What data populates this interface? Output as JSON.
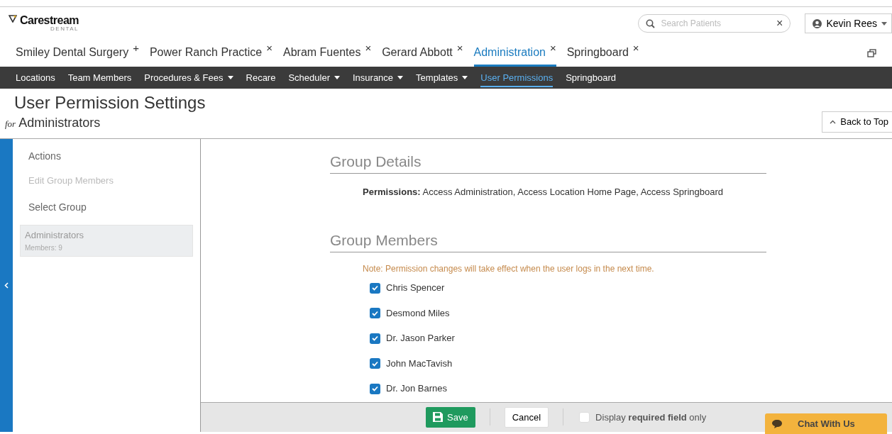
{
  "logo": {
    "name": "Carestream",
    "sub": "DENTAL"
  },
  "search": {
    "placeholder": "Search Patients",
    "clear": "×"
  },
  "user": {
    "name": "Kevin Rees"
  },
  "tabs": [
    {
      "label": "Smiley Dental Surgery",
      "mark": "+",
      "selected": false
    },
    {
      "label": "Power Ranch Practice",
      "mark": "×",
      "selected": false
    },
    {
      "label": "Abram Fuentes",
      "mark": "×",
      "selected": false
    },
    {
      "label": "Gerard Abbott",
      "mark": "×",
      "selected": false
    },
    {
      "label": "Administration",
      "mark": "×",
      "selected": true
    },
    {
      "label": "Springboard",
      "mark": "×",
      "selected": false
    }
  ],
  "menu": [
    {
      "label": "Locations",
      "dropdown": false,
      "selected": false
    },
    {
      "label": "Team Members",
      "dropdown": false,
      "selected": false
    },
    {
      "label": "Procedures & Fees",
      "dropdown": true,
      "selected": false
    },
    {
      "label": "Recare",
      "dropdown": false,
      "selected": false
    },
    {
      "label": "Scheduler",
      "dropdown": true,
      "selected": false
    },
    {
      "label": "Insurance",
      "dropdown": true,
      "selected": false
    },
    {
      "label": "Templates",
      "dropdown": true,
      "selected": false
    },
    {
      "label": "User Permissions",
      "dropdown": false,
      "selected": true
    },
    {
      "label": "Springboard",
      "dropdown": false,
      "selected": false
    }
  ],
  "page": {
    "title": "User Permission Settings",
    "for": "for",
    "subject": "Administrators",
    "back_to_top": "Back to Top"
  },
  "sidebar": {
    "actions_heading": "Actions",
    "actions": [
      {
        "label": "Edit Group Members",
        "disabled": true
      }
    ],
    "group_heading": "Select Group",
    "groups": [
      {
        "name": "Administrators",
        "members": "Members: 9",
        "selected": true
      }
    ]
  },
  "group_details": {
    "heading": "Group Details",
    "permissions": "**Permissions:** Access Administration, Access Location Home Page, Access Springboard"
  },
  "group_members": {
    "heading": "Group Members",
    "note": "Note: Permission changes will take effect when the user logs in the next time.",
    "members": [
      {
        "name": "Chris Spencer",
        "checked": true
      },
      {
        "name": "Desmond Miles",
        "checked": true
      },
      {
        "name": "Dr. Jason Parker",
        "checked": true
      },
      {
        "name": "John MacTavish",
        "checked": true
      },
      {
        "name": "Dr. Jon Barnes",
        "checked": true
      }
    ]
  },
  "footer": {
    "save": "Save",
    "cancel": "Cancel",
    "required_only": {
      "label": "Display **required field** only",
      "checked": false
    },
    "chat": "Chat With Us"
  }
}
